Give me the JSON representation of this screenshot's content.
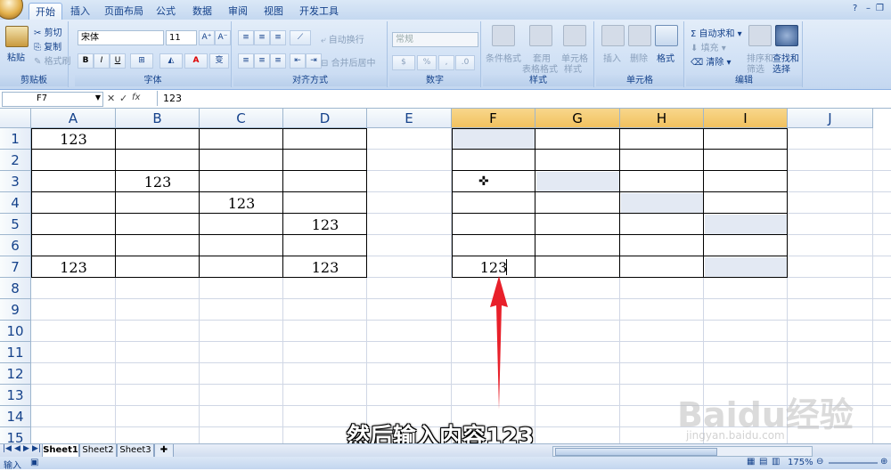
{
  "ribbon_tabs": [
    "开始",
    "插入",
    "页面布局",
    "公式",
    "数据",
    "审阅",
    "视图",
    "开发工具"
  ],
  "clipboard": {
    "paste": "粘贴",
    "cut": "剪切",
    "copy": "复制",
    "format_painter": "格式刷",
    "label": "剪贴板"
  },
  "font": {
    "name": "宋体",
    "size": "11",
    "bold": "B",
    "italic": "I",
    "underline": "U",
    "label": "字体"
  },
  "alignment": {
    "wrap": "自动换行",
    "merge": "合并后居中",
    "label": "对齐方式"
  },
  "number": {
    "format": "常规",
    "label": "数字"
  },
  "styles": {
    "conditional": "条件格式",
    "table": "套用",
    "table2": "表格格式",
    "cell": "单元格",
    "cell2": "样式",
    "label": "样式"
  },
  "cells": {
    "insert": "插入",
    "delete": "删除",
    "format": "格式",
    "label": "单元格"
  },
  "editing": {
    "autosum": "自动求和",
    "fill": "填充",
    "clear": "清除",
    "sort": "排序和",
    "sort2": "筛选",
    "find": "查找和",
    "find2": "选择",
    "label": "编辑"
  },
  "formula_bar": {
    "name_box": "F7",
    "fx": "fx",
    "content": "123"
  },
  "columns": [
    "A",
    "B",
    "C",
    "D",
    "E",
    "F",
    "G",
    "H",
    "I",
    "J"
  ],
  "rows": [
    "1",
    "2",
    "3",
    "4",
    "5",
    "6",
    "7",
    "8",
    "9",
    "10",
    "11",
    "12",
    "13",
    "14",
    "15"
  ],
  "cells_data": [
    {
      "ref": "A1",
      "value": "123"
    },
    {
      "ref": "B3",
      "value": "123"
    },
    {
      "ref": "C4",
      "value": "123"
    },
    {
      "ref": "D5",
      "value": "123"
    },
    {
      "ref": "A7",
      "value": "123"
    },
    {
      "ref": "D7",
      "value": "123"
    },
    {
      "ref": "F7",
      "value": "123"
    }
  ],
  "sheets": [
    "Sheet1",
    "Sheet2",
    "Sheet3"
  ],
  "status": {
    "mode": "输入",
    "zoom": "175%"
  },
  "caption": "然后输入内容123",
  "watermark": {
    "main": "Baidu经验",
    "sub": "jingyan.baidu.com"
  },
  "colors": {
    "accent": "#15428b",
    "selected_header": "#f1c15f",
    "arrow": "#e8202a"
  }
}
